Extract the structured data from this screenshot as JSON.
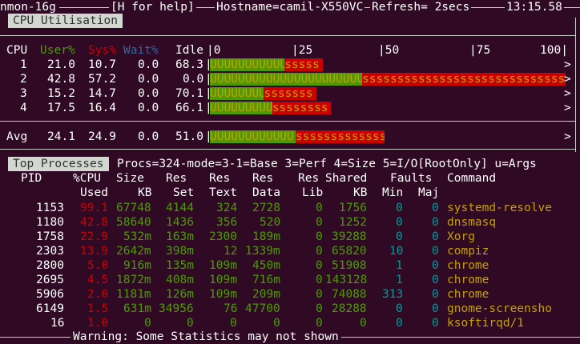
{
  "header": {
    "app": "nmon-16g",
    "help": "[H for help]",
    "hostname": "Hostname=camil-X550VC",
    "refresh": "Refresh= 2secs",
    "time": "13:15.58"
  },
  "cpu": {
    "title": "CPU Utilisation",
    "col_headers": {
      "cpu": "CPU",
      "user": "User%",
      "sys": "Sys%",
      "wait": "Wait%",
      "idle": "Idle"
    },
    "scale": [
      "|0",
      "|25",
      "|50",
      "|75",
      "100|"
    ],
    "rows": [
      {
        "cpu": "1",
        "user": "21.0",
        "sys": "10.7",
        "wait": "0.0",
        "idle": "68.3",
        "user_pct": 21.0,
        "sys_pct": 10.7
      },
      {
        "cpu": "2",
        "user": "42.8",
        "sys": "57.2",
        "wait": "0.0",
        "idle": "0.0",
        "user_pct": 42.8,
        "sys_pct": 57.2
      },
      {
        "cpu": "3",
        "user": "15.2",
        "sys": "14.7",
        "wait": "0.0",
        "idle": "70.1",
        "user_pct": 15.2,
        "sys_pct": 14.7
      },
      {
        "cpu": "4",
        "user": "17.5",
        "sys": "16.4",
        "wait": "0.0",
        "idle": "66.1",
        "user_pct": 17.5,
        "sys_pct": 16.4
      }
    ],
    "avg": {
      "label": "Avg",
      "user": "24.1",
      "sys": "24.9",
      "wait": "0.0",
      "idle": "51.0",
      "user_pct": 24.1,
      "sys_pct": 24.9
    },
    "overflow_mark": ">"
  },
  "processes": {
    "title": "Top Processes",
    "summary": "Procs=324-mode=3-1=Base 3=Perf 4=Size 5=I/O[RootOnly] u=Args",
    "header1": [
      "PID",
      "%CPU",
      "Size",
      "Res",
      "Res",
      "Res",
      "Res",
      "Shared",
      "Faults",
      "Command"
    ],
    "header2": [
      "Used",
      "KB",
      "Set",
      "Text",
      "Data",
      "Lib",
      "KB",
      "Min",
      "Maj"
    ],
    "rows": [
      {
        "pid": "1153",
        "cpu": "99.1",
        "size": "67748",
        "set": "4144",
        "text": "324",
        "data": "2728",
        "lib": "0",
        "shared": "1756",
        "min": "0",
        "maj": "0",
        "cmd": "systemd-resolve"
      },
      {
        "pid": "1180",
        "cpu": "42.8",
        "size": "58640",
        "set": "1436",
        "text": "356",
        "data": "520",
        "lib": "0",
        "shared": "1252",
        "min": "0",
        "maj": "0",
        "cmd": "dnsmasq"
      },
      {
        "pid": "1758",
        "cpu": "22.9",
        "size": "532m",
        "set": "163m",
        "text": "2300",
        "data": "189m",
        "lib": "0",
        "shared": "39288",
        "min": "0",
        "maj": "0",
        "cmd": "Xorg"
      },
      {
        "pid": "2303",
        "cpu": "13.9",
        "size": "2642m",
        "set": "398m",
        "text": "12",
        "data": "1339m",
        "lib": "0",
        "shared": "65820",
        "min": "10",
        "maj": "0",
        "cmd": "compiz"
      },
      {
        "pid": "2800",
        "cpu": "5.0",
        "size": "916m",
        "set": "135m",
        "text": "109m",
        "data": "450m",
        "lib": "0",
        "shared": "51908",
        "min": "1",
        "maj": "0",
        "cmd": "chrome"
      },
      {
        "pid": "2695",
        "cpu": "4.5",
        "size": "1872m",
        "set": "408m",
        "text": "109m",
        "data": "716m",
        "lib": "0",
        "shared": "143128",
        "min": "1",
        "maj": "0",
        "cmd": "chrome"
      },
      {
        "pid": "5906",
        "cpu": "2.0",
        "size": "1181m",
        "set": "126m",
        "text": "109m",
        "data": "209m",
        "lib": "0",
        "shared": "74088",
        "min": "313",
        "maj": "0",
        "cmd": "chrome"
      },
      {
        "pid": "6149",
        "cpu": "1.5",
        "size": "631m",
        "set": "34956",
        "text": "76",
        "data": "47700",
        "lib": "0",
        "shared": "28288",
        "min": "0",
        "maj": "0",
        "cmd": "gnome-screensho"
      },
      {
        "pid": "16",
        "cpu": "1.0",
        "size": "0",
        "set": "0",
        "text": "0",
        "data": "0",
        "lib": "0",
        "shared": "0",
        "min": "0",
        "maj": "0",
        "cmd": "ksoftirqd/1"
      }
    ]
  },
  "footer": {
    "warning": "Warning: Some Statistics may not shown"
  },
  "colors": {
    "bg": "#300a24",
    "user": "#4e9a06",
    "sys": "#cc0000",
    "wait": "#3465a4",
    "cmd": "#c4a000",
    "faults": "#06989a"
  }
}
